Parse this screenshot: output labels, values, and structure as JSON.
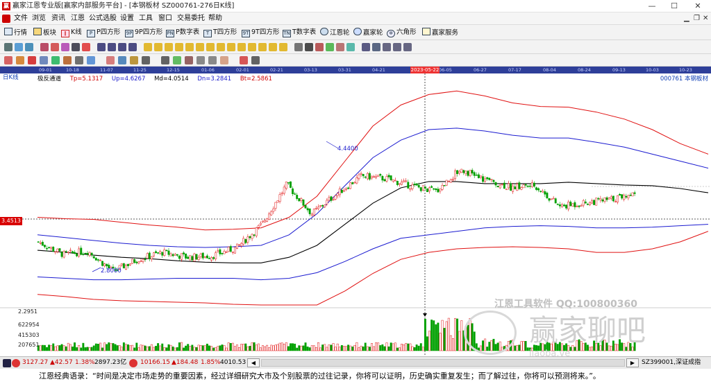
{
  "window": {
    "title": "赢家江恩专业版[赢家内部服务平台] - [本钢板材  SZ000761-276日K线]",
    "minimize": "—",
    "maximize": "☐",
    "close": "✕",
    "app_icon_text": "赢"
  },
  "menu": [
    "文件",
    "浏览",
    "资讯",
    "江恩",
    "公式选股",
    "设置",
    "工具",
    "窗口",
    "交易委托",
    "帮助"
  ],
  "toolbar1": [
    {
      "icon": "grid-icon",
      "label": "行情"
    },
    {
      "icon": "blocks-icon",
      "label": "板块"
    },
    {
      "icon": "candle-icon",
      "label": "K线"
    },
    {
      "icon": "p-square-icon",
      "label": "P四方形"
    },
    {
      "icon": "9p-square-icon",
      "label": "9P四方形"
    },
    {
      "icon": "p-table-icon",
      "label": "P数字表"
    },
    {
      "icon": "t-square-icon",
      "label": "T四方形"
    },
    {
      "icon": "9t-square-icon",
      "label": "9T四方形"
    },
    {
      "icon": "t-table-icon",
      "label": "T数字表"
    },
    {
      "icon": "gann-wheel-icon",
      "label": "江恩轮"
    },
    {
      "icon": "winner-wheel-icon",
      "label": "赢家轮"
    },
    {
      "icon": "hexagon-icon",
      "label": "六角形"
    },
    {
      "icon": "service-icon",
      "label": "赢家服务"
    }
  ],
  "chart_header": {
    "chart_tag": "日K线",
    "indicator_name": "极反通道",
    "tp": "Tp=5.1317",
    "up": "Up=4.6267",
    "md": "Md=4.0514",
    "dn": "Dn=3.2841",
    "bt": "Bt=2.5861",
    "stock": "000761  本钢板材",
    "price_badge": "3.4513",
    "selected_date": "2023-05-22",
    "dates": [
      "09-01",
      "10-18",
      "11-07",
      "11-25",
      "12-15",
      "01-06",
      "02-01",
      "02-21",
      "03-13",
      "03-31",
      "04-21",
      "06-05",
      "06-27",
      "07-17",
      "08-04",
      "08-24",
      "09-13",
      "10-03",
      "10-23"
    ],
    "high_marker": "4.4400",
    "low_marker": "2.8000"
  },
  "volume_axis": [
    "2.2951",
    "622954",
    "415303",
    "207651"
  ],
  "watermark": {
    "line1": "江恩工具软件  QQ:100800360",
    "brand": "赢家聊吧",
    "url": "jiaoba.ve"
  },
  "status": {
    "sh_index": "3127.27",
    "sh_change": "▲42.57",
    "sh_pct": "1.38%",
    "sh_amount": "2897.23亿",
    "sz_index": "10166.15",
    "sz_change": "▲184.48",
    "sz_pct": "1.85%",
    "sz_amount": "4010.53",
    "code": "SZ399001,深证成指"
  },
  "quote": "江恩经典语录：“时间是决定市场走势的重要因素，经过详细研究大市及个别股票的过往记录，你将可以证明，历史确实重复发生；而了解过往，你将可以预测将来。”。",
  "chart_data": {
    "type": "candlestick_with_channel",
    "title": "本钢板材 000761 日K线",
    "x_start": "2022-09-01",
    "x_end": "2023-10-27",
    "ylim_approx": [
      2.3,
      5.6
    ],
    "series": [
      {
        "name": "Tp",
        "color": "#e01010",
        "values": [
          3.55,
          3.53,
          3.52,
          3.48,
          3.44,
          3.41,
          3.37,
          3.38,
          3.4,
          3.55,
          3.85,
          4.35,
          4.85,
          5.15,
          5.3,
          5.35,
          5.28,
          5.18,
          5.13,
          5.12,
          5.05,
          4.95,
          4.8,
          4.6,
          4.45
        ]
      },
      {
        "name": "Up",
        "color": "#1a1ad0",
        "values": [
          3.3,
          3.26,
          3.22,
          3.18,
          3.15,
          3.13,
          3.12,
          3.13,
          3.15,
          3.3,
          3.6,
          4.0,
          4.4,
          4.65,
          4.8,
          4.82,
          4.78,
          4.72,
          4.68,
          4.68,
          4.62,
          4.55,
          4.45,
          4.35,
          4.25
        ]
      },
      {
        "name": "Md",
        "color": "#000000",
        "values": [
          3.08,
          3.05,
          3.01,
          2.98,
          2.96,
          2.93,
          2.91,
          2.9,
          2.9,
          2.98,
          3.15,
          3.45,
          3.75,
          3.97,
          4.06,
          4.06,
          4.03,
          4.03,
          4.03,
          4.05,
          4.03,
          4.01,
          4.0,
          3.96,
          3.9
        ]
      },
      {
        "name": "Dn",
        "color": "#1a1ad0",
        "values": [
          2.7,
          2.68,
          2.66,
          2.66,
          2.67,
          2.68,
          2.68,
          2.68,
          2.66,
          2.68,
          2.76,
          2.92,
          3.1,
          3.25,
          3.3,
          3.35,
          3.4,
          3.42,
          3.43,
          3.42,
          3.4,
          3.4,
          3.41,
          3.43,
          3.45
        ]
      },
      {
        "name": "Bt",
        "color": "#e01010",
        "values": [
          2.45,
          2.42,
          2.38,
          2.36,
          2.35,
          2.34,
          2.33,
          2.31,
          2.3,
          2.3,
          2.3,
          2.5,
          2.75,
          2.95,
          3.05,
          3.1,
          3.12,
          3.13,
          3.12,
          3.1,
          3.05,
          3.05,
          3.1,
          3.2,
          3.35
        ]
      }
    ],
    "close": [
      3.2,
      3.02,
      3.07,
      2.78,
      2.95,
      3.05,
      2.98,
      3.0,
      3.12,
      3.45,
      4.02,
      3.6,
      3.88,
      4.14,
      4.1,
      4.0,
      3.92,
      4.24,
      4.08,
      3.98,
      4.0,
      3.7,
      3.76,
      3.8,
      3.9
    ]
  }
}
